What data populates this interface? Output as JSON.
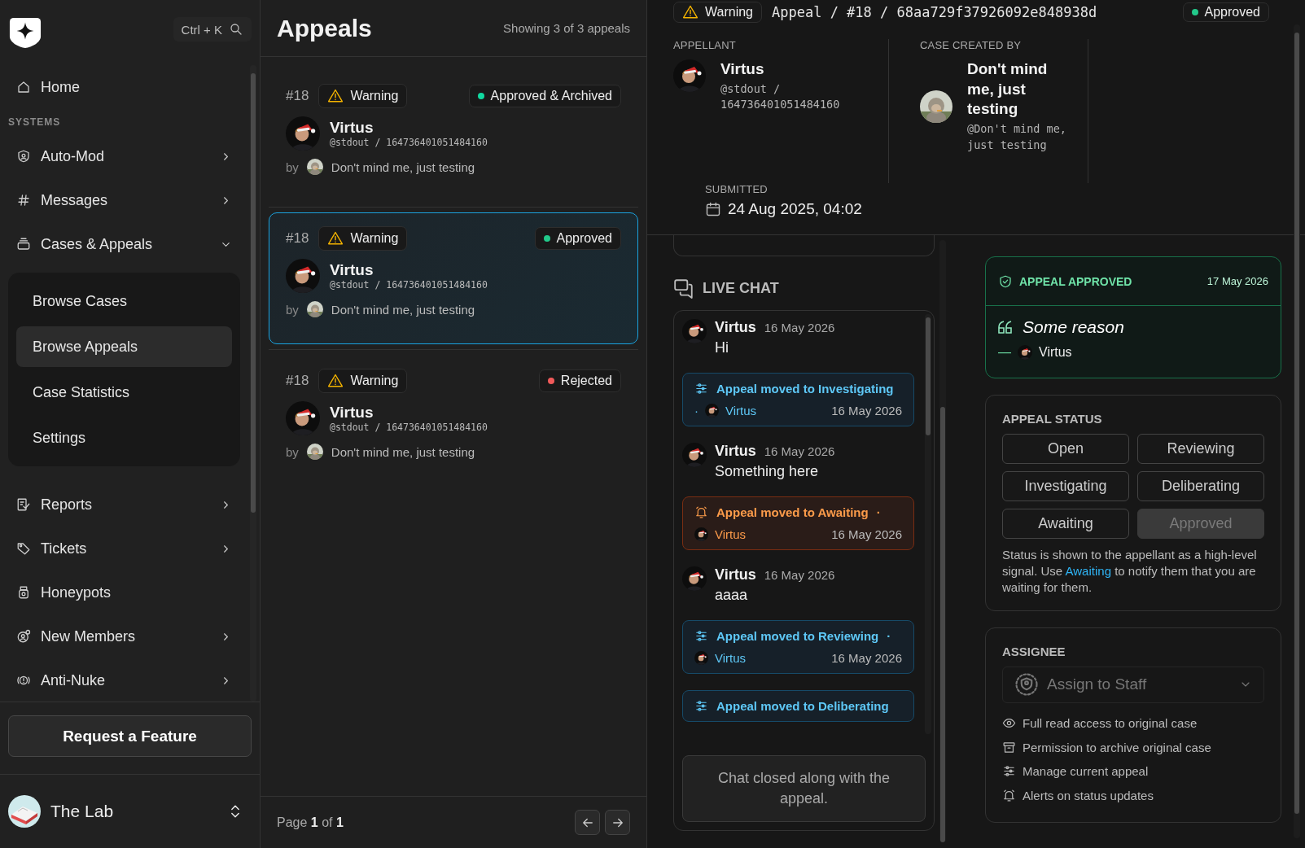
{
  "sidebar": {
    "search_shortcut": "Ctrl + K",
    "home": {
      "label": "Home"
    },
    "section_label": "SYSTEMS",
    "items": [
      {
        "label": "Auto-Mod",
        "expanded": false
      },
      {
        "label": "Messages",
        "expanded": false
      },
      {
        "label": "Cases & Appeals",
        "expanded": true,
        "children": [
          {
            "label": "Browse Cases",
            "selected": false
          },
          {
            "label": "Browse Appeals",
            "selected": true
          },
          {
            "label": "Case Statistics",
            "selected": false
          },
          {
            "label": "Settings",
            "selected": false
          }
        ]
      },
      {
        "label": "Reports",
        "expanded": false
      },
      {
        "label": "Tickets",
        "expanded": false
      },
      {
        "label": "Honeypots"
      },
      {
        "label": "New Members",
        "expanded": false
      },
      {
        "label": "Anti-Nuke",
        "expanded": false
      }
    ],
    "request_button": "Request a Feature",
    "workspace": "The Lab"
  },
  "appeals_list": {
    "title": "Appeals",
    "count": "Showing 3 of 3 appeals",
    "items": [
      {
        "number": "#18",
        "type": "Warning",
        "status": "Approved & Archived",
        "color": "#10d9a0",
        "name": "Virtus",
        "handle": "@stdout / 164736401051484160",
        "by": "by",
        "creator": "Don't mind me, just testing",
        "selected": false
      },
      {
        "number": "#18",
        "type": "Warning",
        "status": "Approved",
        "color": "#22c98a",
        "name": "Virtus",
        "handle": "@stdout / 164736401051484160",
        "by": "by",
        "creator": "Don't mind me, just testing",
        "selected": true
      },
      {
        "number": "#18",
        "type": "Warning",
        "status": "Rejected",
        "color": "#f05a5a",
        "name": "Virtus",
        "handle": "@stdout / 164736401051484160",
        "by": "by",
        "creator": "Don't mind me, just testing",
        "selected": false
      }
    ],
    "pagination": "Page **1** of **1**"
  },
  "detail": {
    "type": "Warning",
    "breadcrumb": "Appeal / #18 / 68aa729f37926092e848938d",
    "status": {
      "label": "Approved",
      "color": "#22c98a"
    },
    "appellant": {
      "label": "APPELLANT",
      "name": "Virtus",
      "handle": "@stdout / 164736401051484160"
    },
    "creator": {
      "label": "CASE CREATED BY",
      "name": "Don't mind me, just testing",
      "handle": "@Don't mind me, just testing"
    },
    "submitted": {
      "label": "SUBMITTED",
      "date": "24 Aug 2025, 04:02"
    },
    "chat": {
      "title": "LIVE CHAT",
      "messages": [
        {
          "kind": "message",
          "author": "Virtus",
          "date": "16 May 2026",
          "text": "Hi"
        },
        {
          "kind": "event",
          "color": "#5ec8f7",
          "title": "Appeal moved to Investigating",
          "author_prefix": "·",
          "author": "Virtus",
          "date": "16 May 2026"
        },
        {
          "kind": "message",
          "author": "Virtus",
          "date": "16 May 2026",
          "text": "Something here"
        },
        {
          "kind": "event",
          "color": "#fb9b4a",
          "title": "Appeal moved to Awaiting",
          "title_suffix": "·",
          "author": "Virtus",
          "date": "16 May 2026"
        },
        {
          "kind": "message",
          "author": "Virtus",
          "date": "16 May 2026",
          "text": "aaaa"
        },
        {
          "kind": "event",
          "color": "#5ec8f7",
          "title": "Appeal moved to Reviewing",
          "title_suffix": "·",
          "author": "Virtus",
          "date": "16 May 2026"
        },
        {
          "kind": "event",
          "color": "#5ec8f7",
          "title": "Appeal moved to Deliberating"
        }
      ],
      "closed_note": "Chat closed along with the appeal."
    },
    "decision": {
      "title": "APPEAL APPROVED",
      "date": "17 May 2026",
      "reason": "Some reason",
      "dash": "—",
      "author": "Virtus"
    },
    "status_panel": {
      "title": "APPEAL STATUS",
      "options": [
        {
          "label": "Open",
          "selected": false
        },
        {
          "label": "Reviewing",
          "selected": false
        },
        {
          "label": "Investigating",
          "selected": false
        },
        {
          "label": "Deliberating",
          "selected": false
        },
        {
          "label": "Awaiting",
          "selected": false
        },
        {
          "label": "Approved",
          "selected": true
        }
      ],
      "note_before": "Status is shown to the appellant as a high-level signal. Use",
      "note_link": "Awaiting",
      "note_after": "to notify them that you are waiting for them."
    },
    "assignee": {
      "title": "ASSIGNEE",
      "placeholder": "Assign to Staff",
      "permissions": [
        "Full read access to original case",
        "Permission to archive original case",
        "Manage current appeal",
        "Alerts on status updates"
      ]
    }
  }
}
